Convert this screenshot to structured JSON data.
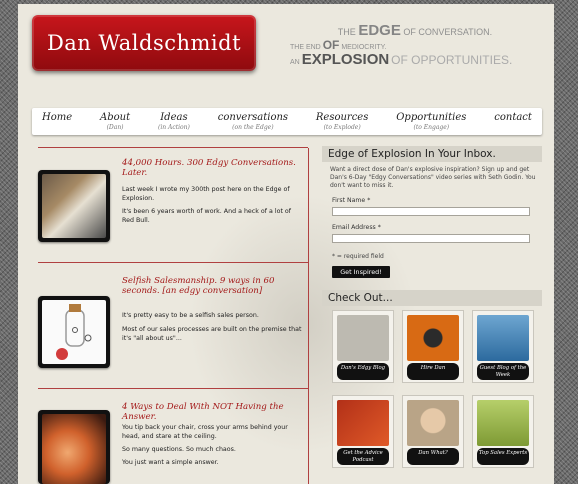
{
  "header": {
    "logo_text": "Dan Waldschmidt",
    "tagline": {
      "the": "THE",
      "edge": "EDGE",
      "of_conversation": "OF CONVERSATION.",
      "the_end": "THE END",
      "of": "OF",
      "mediocrity": "MEDIOCRITY.",
      "an": "AN",
      "explosion": "EXPLOSION",
      "of_opportunities": "OF OPPORTUNITIES."
    }
  },
  "nav": [
    {
      "label": "Home",
      "sub": ""
    },
    {
      "label": "About",
      "sub": "(Dan)"
    },
    {
      "label": "Ideas",
      "sub": "(in Action)"
    },
    {
      "label": "conversations",
      "sub": "(on the Edge)"
    },
    {
      "label": "Resources",
      "sub": "(to Explode)"
    },
    {
      "label": "Opportunities",
      "sub": "(to Engage)"
    },
    {
      "label": "contact",
      "sub": ""
    }
  ],
  "posts": [
    {
      "title": "44,000 Hours. 300 Edgy Conversations. Later.",
      "paragraphs": [
        "Last week I wrote my 300th post here on the Edge of Explosion.",
        "It's been 6 years worth of work. And a heck of a lot of Red Bull."
      ],
      "thumb_icon": "desk-photo"
    },
    {
      "title": "Selfish Salesmanship. 9 ways in 60 seconds. [an edgy conversation]",
      "paragraphs": [
        "It's pretty easy to be a selfish sales person.",
        "Most of our sales processes are built on the premise that it's \"all about us\"..."
      ],
      "thumb_icon": "bottle-illustration"
    },
    {
      "title": "4 Ways to Deal With NOT Having the Answer.",
      "paragraphs": [
        "You tip back your chair, cross your arms behind your head, and stare at the ceiling.",
        "So many questions. So much chaos.",
        "You just want a simple answer."
      ],
      "thumb_icon": "ear-photo"
    }
  ],
  "newsletter": {
    "heading": "Edge of Explosion In Your Inbox.",
    "intro": "Want a direct dose of Dan's explosive inspiration? Sign up and get Dan's 6-Day \"Edgy Conversations\" video series with Seth Godin. You don't want to miss it.",
    "first_name_label": "First Name *",
    "email_label": "Email Address *",
    "first_name_value": "",
    "email_value": "",
    "required_note": "* = required field",
    "submit_label": "Get Inspired!"
  },
  "check_out": {
    "heading": "Check Out...",
    "tiles": [
      {
        "caption": "Dan's Edgy Blog",
        "icon": "edge-of-explosion-logo",
        "color": "#bdbab1"
      },
      {
        "caption": "Hire Dan",
        "icon": "orange-phone",
        "color": "#d86a14"
      },
      {
        "caption": "Guest Blog of the Week",
        "icon": "keyboard-hands",
        "color": "#3d7fb3"
      },
      {
        "caption": "Get the Advice Podcast",
        "icon": "get-the-advice",
        "color": "#b23018"
      },
      {
        "caption": "Dan What?",
        "icon": "dan-face",
        "color": "#b9a487"
      },
      {
        "caption": "Top Sales Experts",
        "icon": "expert-advice",
        "color": "#94b046"
      }
    ]
  },
  "colors": {
    "accent": "#a31818",
    "logo_red": "#c8161c",
    "page_bg": "#ebe8de"
  }
}
